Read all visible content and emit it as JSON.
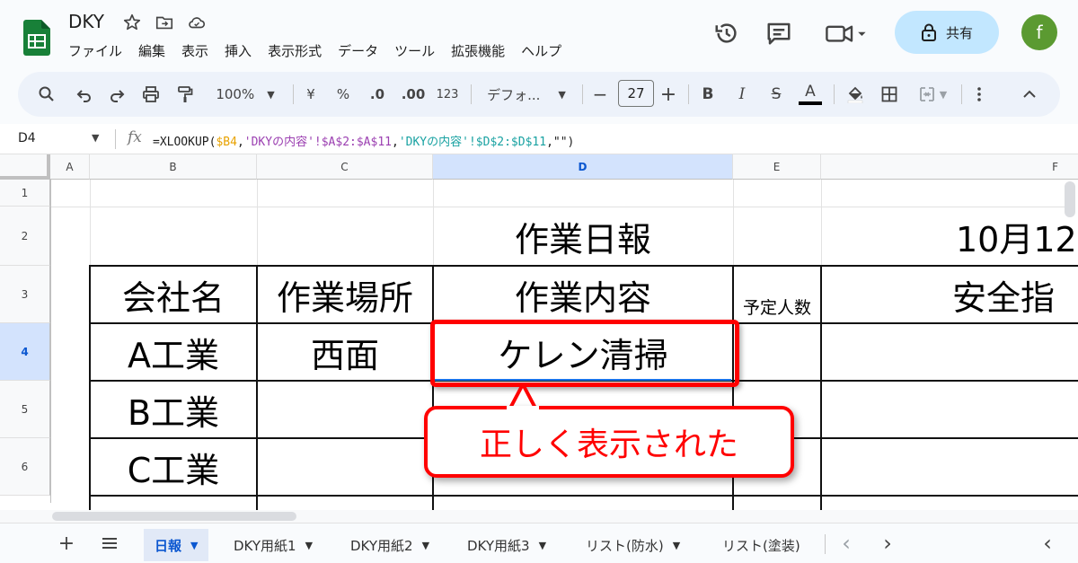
{
  "doc": {
    "title": "DKY"
  },
  "menu": [
    "ファイル",
    "編集",
    "表示",
    "挿入",
    "表示形式",
    "データ",
    "ツール",
    "拡張機能",
    "ヘルプ"
  ],
  "share": {
    "label": "共有"
  },
  "user": {
    "initial": "f"
  },
  "toolbar": {
    "zoom": "100%",
    "currency": "¥",
    "percent": "%",
    "dec_decrease": ".0",
    "dec_increase": ".00",
    "number_format": "123",
    "font": "デフォ...",
    "font_size": "27",
    "minus": "−",
    "plus": "+",
    "bold": "B",
    "italic": "I",
    "strike": "S",
    "text_color": "A"
  },
  "formula_bar": {
    "name_box": "D4",
    "fx": "fx",
    "formula_prefix": "=XLOOKUP(",
    "ref1": "$B4",
    "sep1": ",",
    "ref2": "'DKYの内容'!$A$2:$A$11",
    "sep2": ",",
    "ref3": "'DKYの内容'!$D$2:$D$11",
    "formula_suffix": ",\"\")"
  },
  "grid": {
    "columns": [
      "A",
      "B",
      "C",
      "D",
      "E",
      "F"
    ],
    "rows": [
      "1",
      "2",
      "3",
      "4",
      "5",
      "6"
    ],
    "active_cell": "D4",
    "cells": {
      "D2": "作業日報",
      "F2": "10月12",
      "B3": "会社名",
      "C3": "作業場所",
      "D3": "作業内容",
      "E3": "予定人数",
      "F3": "安全指",
      "B4": "A工業",
      "C4": "西面",
      "D4": "ケレン清掃",
      "B5": "B工業",
      "B6": "C工業"
    }
  },
  "annotation": {
    "text": "正しく表示された",
    "color": "#ff0000"
  },
  "sheet_tabs": [
    {
      "label": "日報",
      "active": true
    },
    {
      "label": "DKY用紙1",
      "active": false
    },
    {
      "label": "DKY用紙2",
      "active": false
    },
    {
      "label": "DKY用紙3",
      "active": false
    },
    {
      "label": "リスト(防水)",
      "active": false
    },
    {
      "label": "リスト(塗装)",
      "active": false
    }
  ],
  "tabbar": {
    "add": "+",
    "prev": "‹",
    "next": "›",
    "collapse": "‹"
  },
  "colors": {
    "accent": "#0b57d0",
    "share_bg": "#c2e7ff",
    "sheets_green": "#188038"
  }
}
